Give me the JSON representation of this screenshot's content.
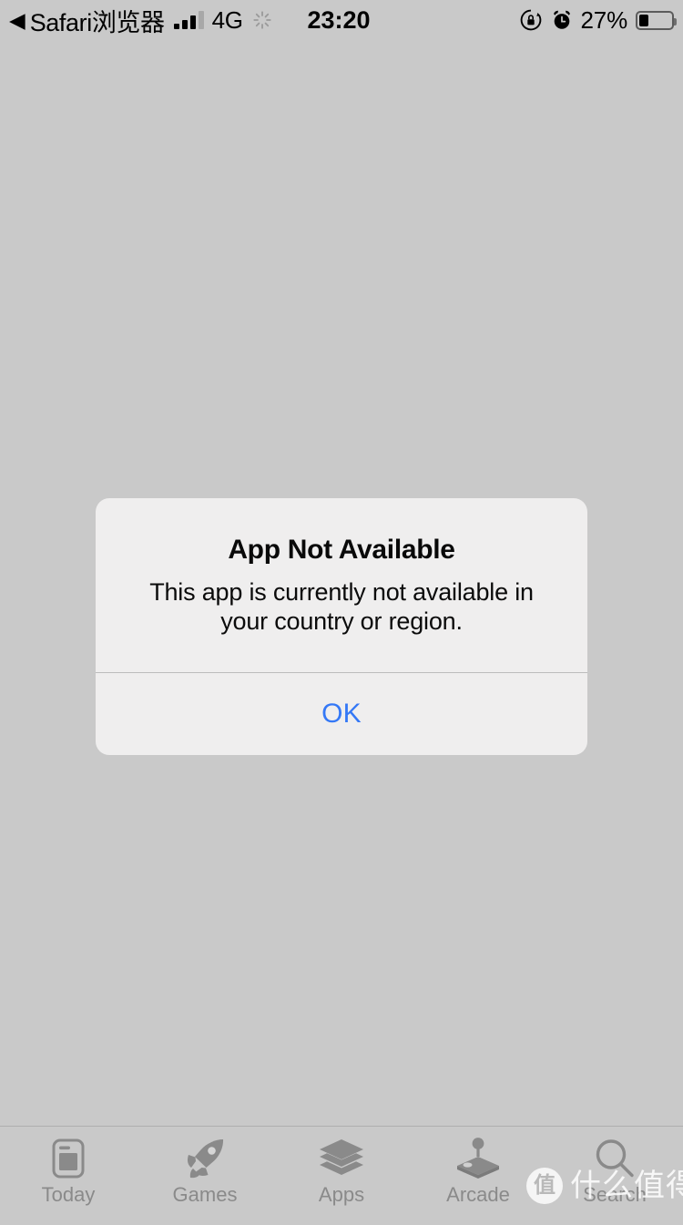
{
  "status_bar": {
    "back_arrow": "◀",
    "return_app": "Safari浏览器",
    "signal_bars_filled": 3,
    "signal_bars_total": 4,
    "network": "4G",
    "activity_indicator": "spinner-icon",
    "time": "23:20",
    "rotation_lock_icon": "rotation-lock-icon",
    "alarm_icon": "alarm-clock-icon",
    "battery_percent": "27%",
    "battery_level": 27
  },
  "alert": {
    "title": "App Not Available",
    "message": "This app is currently not available in your country or region.",
    "ok_label": "OK",
    "accent_color": "#3478f6",
    "background_color": "#efeeee"
  },
  "tab_bar": {
    "items": [
      {
        "label": "Today",
        "icon": "today-card-icon"
      },
      {
        "label": "Games",
        "icon": "rocket-icon"
      },
      {
        "label": "Apps",
        "icon": "layers-icon"
      },
      {
        "label": "Arcade",
        "icon": "joystick-icon"
      },
      {
        "label": "Search",
        "icon": "search-icon"
      }
    ],
    "inactive_color": "#8a8a8a"
  },
  "watermark": {
    "logo_char": "值",
    "text": "什么值得买"
  },
  "screen": {
    "dimmed_background_color": "#c9c9c9"
  }
}
